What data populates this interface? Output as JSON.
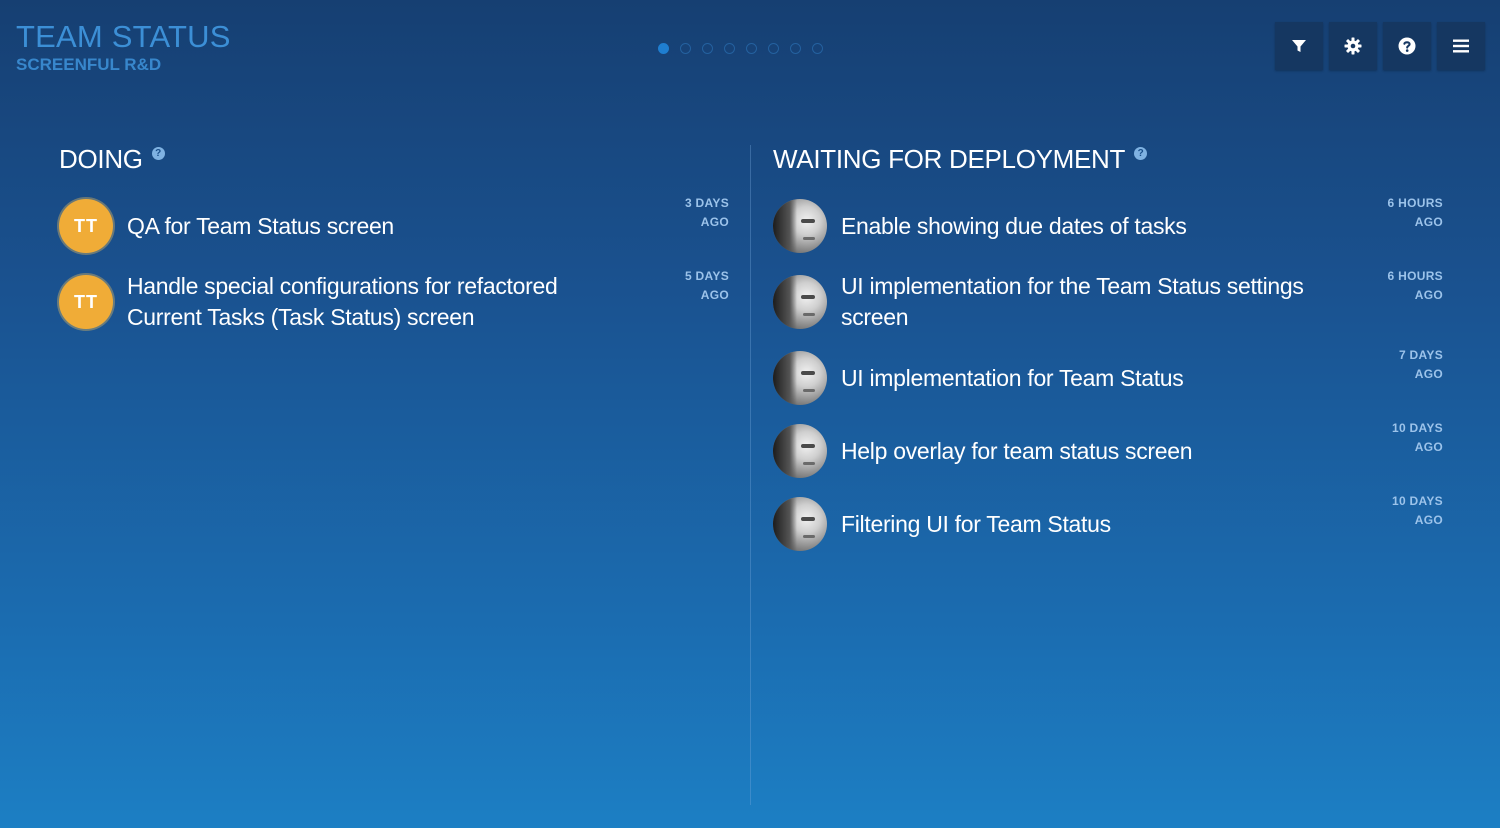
{
  "header": {
    "title": "TEAM STATUS",
    "subtitle": "SCREENFUL R&D",
    "pager": {
      "count": 8,
      "active_index": 0
    },
    "toolbar": [
      {
        "icon": "filter-icon"
      },
      {
        "icon": "gear-icon"
      },
      {
        "icon": "help-icon"
      },
      {
        "icon": "menu-icon"
      }
    ]
  },
  "columns": {
    "doing": {
      "title": "DOING",
      "tasks": [
        {
          "title": "QA for Team Status screen",
          "age_value": "3 DAYS",
          "age_suffix": "AGO",
          "avatar": "TT"
        },
        {
          "title": "Handle special configurations for refactored Current Tasks (Task Status) screen",
          "age_value": "5 DAYS",
          "age_suffix": "AGO",
          "avatar": "TT"
        }
      ]
    },
    "waiting": {
      "title": "WAITING FOR DEPLOYMENT",
      "tasks": [
        {
          "title": "Enable showing due dates of tasks",
          "age_value": "6 HOURS",
          "age_suffix": "AGO"
        },
        {
          "title": "UI implementation for the Team Status settings screen",
          "age_value": "6 HOURS",
          "age_suffix": "AGO"
        },
        {
          "title": "UI implementation for Team Status",
          "age_value": "7 DAYS",
          "age_suffix": "AGO"
        },
        {
          "title": "Help overlay for team status screen",
          "age_value": "10 DAYS",
          "age_suffix": "AGO"
        },
        {
          "title": "Filtering UI for Team Status",
          "age_value": "10 DAYS",
          "age_suffix": "AGO"
        }
      ]
    }
  }
}
